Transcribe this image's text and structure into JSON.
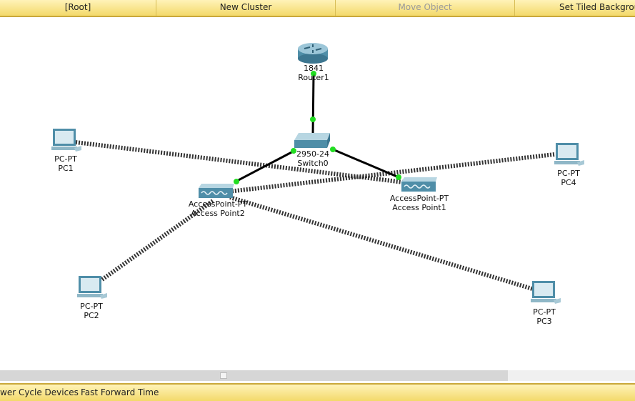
{
  "toolbar": {
    "root": "[Root]",
    "new_cluster": "New Cluster",
    "move_object": "Move Object",
    "set_tiled_background": "Set Tiled Backgrou"
  },
  "devices": {
    "router1": {
      "model": "1841",
      "name": "Router1"
    },
    "switch0": {
      "model": "2950-24",
      "name": "Switch0"
    },
    "ap1": {
      "model": "AccessPoint-PT",
      "name": "Access Point1"
    },
    "ap2": {
      "model": "AccessPoint-PT",
      "name": "Access Point2"
    },
    "pc1": {
      "model": "PC-PT",
      "name": "PC1"
    },
    "pc2": {
      "model": "PC-PT",
      "name": "PC2"
    },
    "pc3": {
      "model": "PC-PT",
      "name": "PC3"
    },
    "pc4": {
      "model": "PC-PT",
      "name": "PC4"
    }
  },
  "colors": {
    "link_up": "#22dd22",
    "bar": "#f3d96a"
  },
  "statusbar": {
    "power_cycle": "wer Cycle Devices",
    "fast_forward": "Fast Forward Time"
  }
}
